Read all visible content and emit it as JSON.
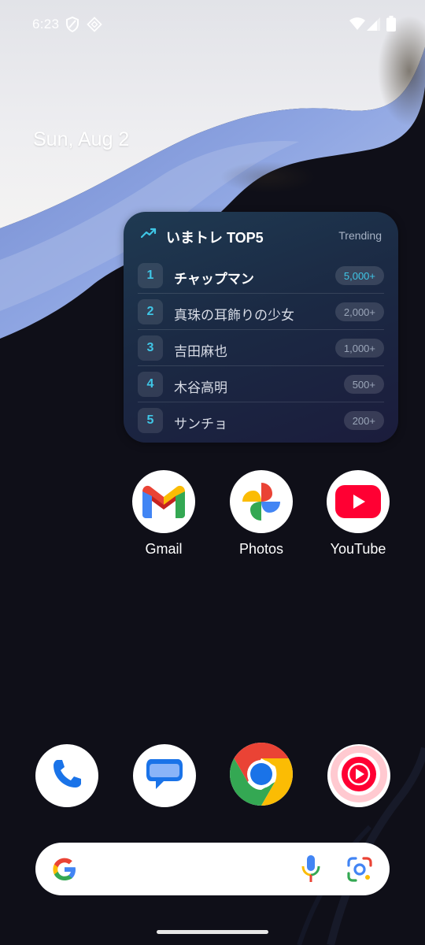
{
  "status_bar": {
    "time": "6:23",
    "left_icons": [
      "shield-icon",
      "vpn-diamond-icon"
    ],
    "right_icons": [
      "wifi-icon",
      "signal-icon",
      "battery-icon"
    ]
  },
  "home": {
    "date": "Sun, Aug 2"
  },
  "widget": {
    "title": "いまトレ TOP5",
    "trending_label": "Trending",
    "accent_color": "#3fc6e6",
    "items": [
      {
        "rank": "1",
        "name": "チャップマン",
        "count": "5,000+"
      },
      {
        "rank": "2",
        "name": "真珠の耳飾りの少女",
        "count": "2,000+"
      },
      {
        "rank": "3",
        "name": "吉田麻也",
        "count": "1,000+"
      },
      {
        "rank": "4",
        "name": "木谷高明",
        "count": "500+"
      },
      {
        "rank": "5",
        "name": "サンチョ",
        "count": "200+"
      }
    ]
  },
  "apps": [
    {
      "label": "Gmail",
      "icon": "gmail-icon"
    },
    {
      "label": "Photos",
      "icon": "google-photos-icon"
    },
    {
      "label": "YouTube",
      "icon": "youtube-icon"
    }
  ],
  "dock": [
    {
      "icon": "phone-icon"
    },
    {
      "icon": "messages-icon"
    },
    {
      "icon": "chrome-icon"
    },
    {
      "icon": "youtube-music-icon"
    }
  ],
  "search": {
    "icons": [
      "google-g-icon",
      "microphone-icon",
      "google-lens-icon"
    ]
  },
  "colors": {
    "wallpaper_light": "#e8e8ec",
    "wallpaper_blue": "#7f96d6",
    "wallpaper_dark": "#0f0f18"
  }
}
